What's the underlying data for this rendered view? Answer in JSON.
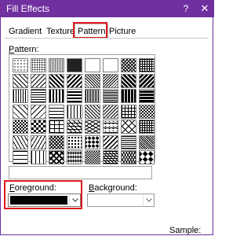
{
  "window": {
    "title": "Fill Effects",
    "help_label": "?",
    "close_label": "✕",
    "accent_color": "#7030a0",
    "highlight_color": "#e0191e"
  },
  "tabs": [
    {
      "label": "Gradient",
      "selected": false
    },
    {
      "label": "Texture",
      "selected": false
    },
    {
      "label": "Pattern",
      "selected": true
    },
    {
      "label": "Picture",
      "selected": false
    }
  ],
  "pattern": {
    "label_prefix": "",
    "label_hotkey": "P",
    "label_rest": "attern:",
    "rows": 7,
    "cols": 8
  },
  "foreground": {
    "label_hotkey": "F",
    "label_rest": "oreground:",
    "color": "#000000"
  },
  "background": {
    "label_hotkey": "B",
    "label_rest": "ackground:",
    "color": "#ffffff"
  },
  "sample": {
    "label": "Sample:"
  }
}
